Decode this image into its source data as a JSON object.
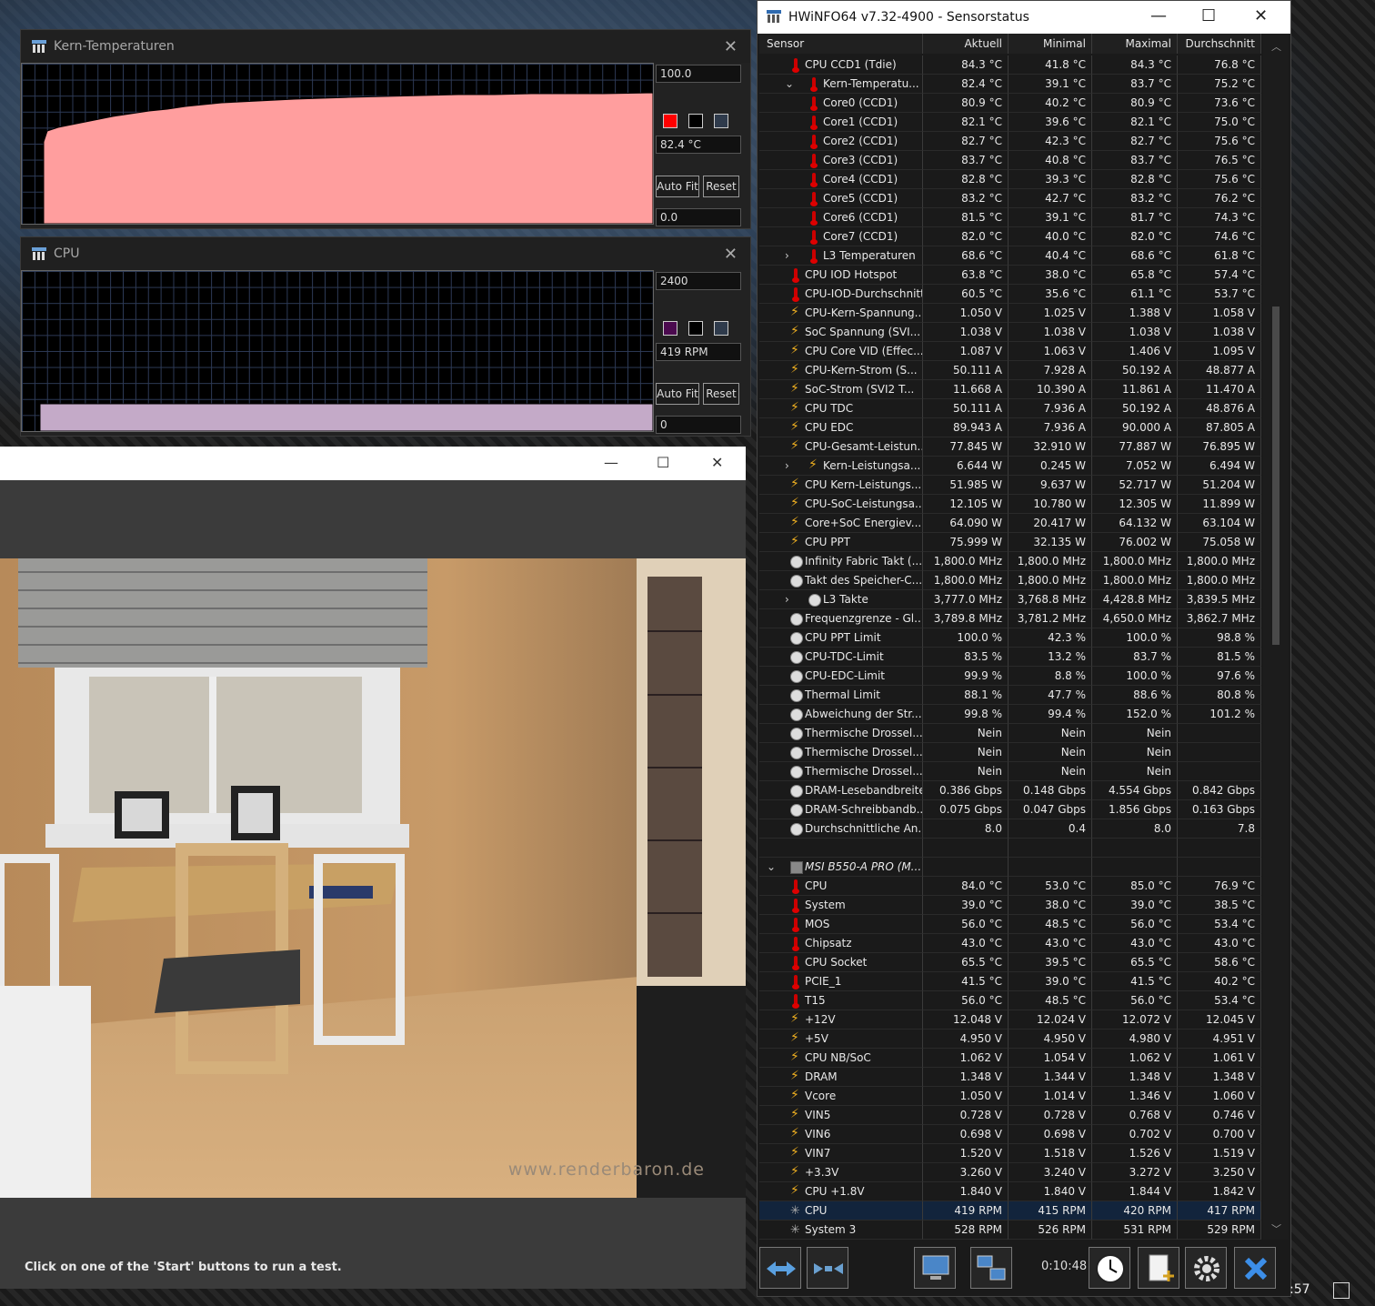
{
  "graph1": {
    "title": "Kern-Temperaturen",
    "max": "100.0",
    "current": "82.4 °C",
    "min": "0.0",
    "autofit": "Auto Fit",
    "reset": "Reset",
    "color": "#ff9e9e"
  },
  "graph2": {
    "title": "CPU",
    "max": "2400",
    "current": "419 RPM",
    "min": "0",
    "autofit": "Auto Fit",
    "reset": "Reset",
    "color": "#c4aac8"
  },
  "render": {
    "watermark": "www.renderbaron.de",
    "status": "Click on one of the 'Start' buttons to run a test."
  },
  "hwinfo": {
    "title": "HWiNFO64 v7.32-4900 - Sensorstatus",
    "columns": [
      "Sensor",
      "Aktuell",
      "Minimal",
      "Maximal",
      "Durchschnitt"
    ],
    "rows": [
      {
        "icon": "therm",
        "indent": 1,
        "label": "CPU CCD1 (Tdie)",
        "v": [
          "84.3 °C",
          "41.8 °C",
          "84.3 °C",
          "76.8 °C"
        ]
      },
      {
        "icon": "therm",
        "indent": 2,
        "exp": "⌄",
        "label": "Kern-Temperatu...",
        "v": [
          "82.4 °C",
          "39.1 °C",
          "83.7 °C",
          "75.2 °C"
        ]
      },
      {
        "icon": "therm",
        "indent": 2,
        "label": "Core0 (CCD1)",
        "v": [
          "80.9 °C",
          "40.2 °C",
          "80.9 °C",
          "73.6 °C"
        ]
      },
      {
        "icon": "therm",
        "indent": 2,
        "label": "Core1 (CCD1)",
        "v": [
          "82.1 °C",
          "39.6 °C",
          "82.1 °C",
          "75.0 °C"
        ]
      },
      {
        "icon": "therm",
        "indent": 2,
        "label": "Core2 (CCD1)",
        "v": [
          "82.7 °C",
          "42.3 °C",
          "82.7 °C",
          "75.6 °C"
        ]
      },
      {
        "icon": "therm",
        "indent": 2,
        "label": "Core3 (CCD1)",
        "v": [
          "83.7 °C",
          "40.8 °C",
          "83.7 °C",
          "76.5 °C"
        ]
      },
      {
        "icon": "therm",
        "indent": 2,
        "label": "Core4 (CCD1)",
        "v": [
          "82.8 °C",
          "39.3 °C",
          "82.8 °C",
          "75.6 °C"
        ]
      },
      {
        "icon": "therm",
        "indent": 2,
        "label": "Core5 (CCD1)",
        "v": [
          "83.2 °C",
          "42.7 °C",
          "83.2 °C",
          "76.2 °C"
        ]
      },
      {
        "icon": "therm",
        "indent": 2,
        "label": "Core6 (CCD1)",
        "v": [
          "81.5 °C",
          "39.1 °C",
          "81.7 °C",
          "74.3 °C"
        ]
      },
      {
        "icon": "therm",
        "indent": 2,
        "label": "Core7 (CCD1)",
        "v": [
          "82.0 °C",
          "40.0 °C",
          "82.0 °C",
          "74.6 °C"
        ]
      },
      {
        "icon": "therm",
        "indent": 2,
        "exp": "›",
        "label": "L3 Temperaturen",
        "v": [
          "68.6 °C",
          "40.4 °C",
          "68.6 °C",
          "61.8 °C"
        ]
      },
      {
        "icon": "therm",
        "indent": 1,
        "label": "CPU IOD Hotspot",
        "v": [
          "63.8 °C",
          "38.0 °C",
          "65.8 °C",
          "57.4 °C"
        ]
      },
      {
        "icon": "therm",
        "indent": 1,
        "label": "CPU-IOD-Durchschnitt",
        "v": [
          "60.5 °C",
          "35.6 °C",
          "61.1 °C",
          "53.7 °C"
        ]
      },
      {
        "icon": "volt",
        "indent": 1,
        "label": "CPU-Kern-Spannung...",
        "v": [
          "1.050 V",
          "1.025 V",
          "1.388 V",
          "1.058 V"
        ]
      },
      {
        "icon": "volt",
        "indent": 1,
        "label": "SoC Spannung (SVI...",
        "v": [
          "1.038 V",
          "1.038 V",
          "1.038 V",
          "1.038 V"
        ]
      },
      {
        "icon": "volt",
        "indent": 1,
        "label": "CPU Core VID (Effec...",
        "v": [
          "1.087 V",
          "1.063 V",
          "1.406 V",
          "1.095 V"
        ]
      },
      {
        "icon": "volt",
        "indent": 1,
        "label": "CPU-Kern-Strom (S...",
        "v": [
          "50.111 A",
          "7.928 A",
          "50.192 A",
          "48.877 A"
        ]
      },
      {
        "icon": "volt",
        "indent": 1,
        "label": "SoC-Strom (SVI2 T...",
        "v": [
          "11.668 A",
          "10.390 A",
          "11.861 A",
          "11.470 A"
        ]
      },
      {
        "icon": "volt",
        "indent": 1,
        "label": "CPU TDC",
        "v": [
          "50.111 A",
          "7.936 A",
          "50.192 A",
          "48.876 A"
        ]
      },
      {
        "icon": "volt",
        "indent": 1,
        "label": "CPU EDC",
        "v": [
          "89.943 A",
          "7.936 A",
          "90.000 A",
          "87.805 A"
        ]
      },
      {
        "icon": "volt",
        "indent": 1,
        "label": "CPU-Gesamt-Leistun...",
        "v": [
          "77.845 W",
          "32.910 W",
          "77.887 W",
          "76.895 W"
        ]
      },
      {
        "icon": "volt",
        "indent": 2,
        "exp": "›",
        "label": "Kern-Leistungsa...",
        "v": [
          "6.644 W",
          "0.245 W",
          "7.052 W",
          "6.494 W"
        ]
      },
      {
        "icon": "volt",
        "indent": 1,
        "label": "CPU Kern-Leistungs...",
        "v": [
          "51.985 W",
          "9.637 W",
          "52.717 W",
          "51.204 W"
        ]
      },
      {
        "icon": "volt",
        "indent": 1,
        "label": "CPU-SoC-Leistungsa...",
        "v": [
          "12.105 W",
          "10.780 W",
          "12.305 W",
          "11.899 W"
        ]
      },
      {
        "icon": "volt",
        "indent": 1,
        "label": "Core+SoC Energiev...",
        "v": [
          "64.090 W",
          "20.417 W",
          "64.132 W",
          "63.104 W"
        ]
      },
      {
        "icon": "volt",
        "indent": 1,
        "label": "CPU PPT",
        "v": [
          "75.999 W",
          "32.135 W",
          "76.002 W",
          "75.058 W"
        ]
      },
      {
        "icon": "clock",
        "indent": 1,
        "label": "Infinity Fabric Takt (...",
        "v": [
          "1,800.0 MHz",
          "1,800.0 MHz",
          "1,800.0 MHz",
          "1,800.0 MHz"
        ]
      },
      {
        "icon": "clock",
        "indent": 1,
        "label": "Takt des Speicher-C...",
        "v": [
          "1,800.0 MHz",
          "1,800.0 MHz",
          "1,800.0 MHz",
          "1,800.0 MHz"
        ]
      },
      {
        "icon": "clock",
        "indent": 2,
        "exp": "›",
        "label": "L3 Takte",
        "v": [
          "3,777.0 MHz",
          "3,768.8 MHz",
          "4,428.8 MHz",
          "3,839.5 MHz"
        ]
      },
      {
        "icon": "clock",
        "indent": 1,
        "label": "Frequenzgrenze - Gl...",
        "v": [
          "3,789.8 MHz",
          "3,781.2 MHz",
          "4,650.0 MHz",
          "3,862.7 MHz"
        ]
      },
      {
        "icon": "clock",
        "indent": 1,
        "label": "CPU PPT Limit",
        "v": [
          "100.0 %",
          "42.3 %",
          "100.0 %",
          "98.8 %"
        ]
      },
      {
        "icon": "clock",
        "indent": 1,
        "label": "CPU-TDC-Limit",
        "v": [
          "83.5 %",
          "13.2 %",
          "83.7 %",
          "81.5 %"
        ]
      },
      {
        "icon": "clock",
        "indent": 1,
        "label": "CPU-EDC-Limit",
        "v": [
          "99.9 %",
          "8.8 %",
          "100.0 %",
          "97.6 %"
        ]
      },
      {
        "icon": "clock",
        "indent": 1,
        "label": "Thermal Limit",
        "v": [
          "88.1 %",
          "47.7 %",
          "88.6 %",
          "80.8 %"
        ]
      },
      {
        "icon": "clock",
        "indent": 1,
        "label": "Abweichung der Str...",
        "v": [
          "99.8 %",
          "99.4 %",
          "152.0 %",
          "101.2 %"
        ]
      },
      {
        "icon": "clock",
        "indent": 1,
        "label": "Thermische Drossel...",
        "v": [
          "Nein",
          "Nein",
          "Nein",
          ""
        ]
      },
      {
        "icon": "clock",
        "indent": 1,
        "label": "Thermische Drossel...",
        "v": [
          "Nein",
          "Nein",
          "Nein",
          ""
        ]
      },
      {
        "icon": "clock",
        "indent": 1,
        "label": "Thermische Drossel...",
        "v": [
          "Nein",
          "Nein",
          "Nein",
          ""
        ]
      },
      {
        "icon": "clock",
        "indent": 1,
        "label": "DRAM-Lesebandbreite",
        "v": [
          "0.386 Gbps",
          "0.148 Gbps",
          "4.554 Gbps",
          "0.842 Gbps"
        ]
      },
      {
        "icon": "clock",
        "indent": 1,
        "label": "DRAM-Schreibbandb...",
        "v": [
          "0.075 Gbps",
          "0.047 Gbps",
          "1.856 Gbps",
          "0.163 Gbps"
        ]
      },
      {
        "icon": "clock",
        "indent": 1,
        "label": "Durchschnittliche An...",
        "v": [
          "8.0",
          "0.4",
          "8.0",
          "7.8"
        ]
      },
      {
        "icon": "",
        "indent": 1,
        "label": "",
        "v": [
          "",
          "",
          "",
          ""
        ]
      },
      {
        "icon": "board",
        "indent": 1,
        "exp": "⌄",
        "group": true,
        "label": "MSI B550-A PRO (M...",
        "v": [
          "",
          "",
          "",
          ""
        ]
      },
      {
        "icon": "therm",
        "indent": 1,
        "label": "CPU",
        "v": [
          "84.0 °C",
          "53.0 °C",
          "85.0 °C",
          "76.9 °C"
        ]
      },
      {
        "icon": "therm",
        "indent": 1,
        "label": "System",
        "v": [
          "39.0 °C",
          "38.0 °C",
          "39.0 °C",
          "38.5 °C"
        ]
      },
      {
        "icon": "therm",
        "indent": 1,
        "label": "MOS",
        "v": [
          "56.0 °C",
          "48.5 °C",
          "56.0 °C",
          "53.4 °C"
        ]
      },
      {
        "icon": "therm",
        "indent": 1,
        "label": "Chipsatz",
        "v": [
          "43.0 °C",
          "43.0 °C",
          "43.0 °C",
          "43.0 °C"
        ]
      },
      {
        "icon": "therm",
        "indent": 1,
        "label": "CPU Socket",
        "v": [
          "65.5 °C",
          "39.5 °C",
          "65.5 °C",
          "58.6 °C"
        ]
      },
      {
        "icon": "therm",
        "indent": 1,
        "label": "PCIE_1",
        "v": [
          "41.5 °C",
          "39.0 °C",
          "41.5 °C",
          "40.2 °C"
        ]
      },
      {
        "icon": "therm",
        "indent": 1,
        "label": "T15",
        "v": [
          "56.0 °C",
          "48.5 °C",
          "56.0 °C",
          "53.4 °C"
        ]
      },
      {
        "icon": "volt",
        "indent": 1,
        "label": "+12V",
        "v": [
          "12.048 V",
          "12.024 V",
          "12.072 V",
          "12.045 V"
        ]
      },
      {
        "icon": "volt",
        "indent": 1,
        "label": "+5V",
        "v": [
          "4.950 V",
          "4.950 V",
          "4.980 V",
          "4.951 V"
        ]
      },
      {
        "icon": "volt",
        "indent": 1,
        "label": "CPU NB/SoC",
        "v": [
          "1.062 V",
          "1.054 V",
          "1.062 V",
          "1.061 V"
        ]
      },
      {
        "icon": "volt",
        "indent": 1,
        "label": "DRAM",
        "v": [
          "1.348 V",
          "1.344 V",
          "1.348 V",
          "1.348 V"
        ]
      },
      {
        "icon": "volt",
        "indent": 1,
        "label": "Vcore",
        "v": [
          "1.050 V",
          "1.014 V",
          "1.346 V",
          "1.060 V"
        ]
      },
      {
        "icon": "volt",
        "indent": 1,
        "label": "VIN5",
        "v": [
          "0.728 V",
          "0.728 V",
          "0.768 V",
          "0.746 V"
        ]
      },
      {
        "icon": "volt",
        "indent": 1,
        "label": "VIN6",
        "v": [
          "0.698 V",
          "0.698 V",
          "0.702 V",
          "0.700 V"
        ]
      },
      {
        "icon": "volt",
        "indent": 1,
        "label": "VIN7",
        "v": [
          "1.520 V",
          "1.518 V",
          "1.526 V",
          "1.519 V"
        ]
      },
      {
        "icon": "volt",
        "indent": 1,
        "label": "+3.3V",
        "v": [
          "3.260 V",
          "3.240 V",
          "3.272 V",
          "3.250 V"
        ]
      },
      {
        "icon": "volt",
        "indent": 1,
        "label": "CPU +1.8V",
        "v": [
          "1.840 V",
          "1.840 V",
          "1.844 V",
          "1.842 V"
        ]
      },
      {
        "icon": "fan",
        "indent": 1,
        "sel": true,
        "label": "CPU",
        "v": [
          "419 RPM",
          "415 RPM",
          "420 RPM",
          "417 RPM"
        ]
      },
      {
        "icon": "fan",
        "indent": 1,
        "label": "System 3",
        "v": [
          "528 RPM",
          "526 RPM",
          "531 RPM",
          "529 RPM"
        ]
      }
    ],
    "timer": "0:10:48"
  },
  "taskbar": {
    "clock_fragment": ":57"
  }
}
